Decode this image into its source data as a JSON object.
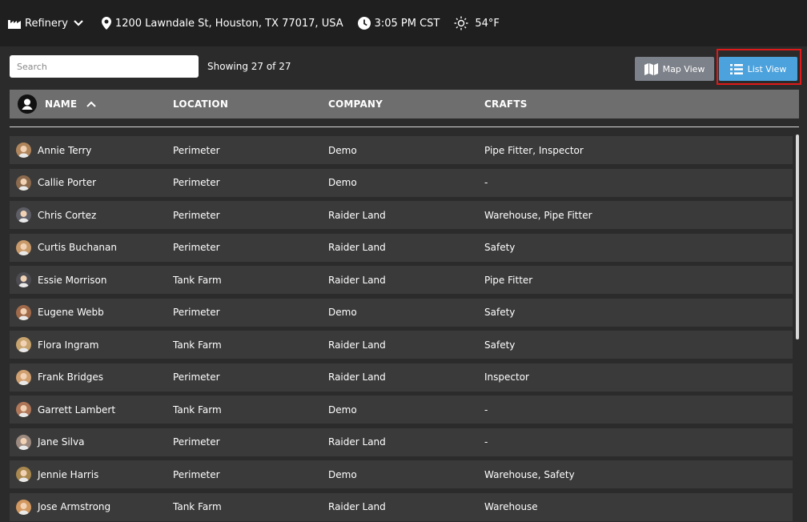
{
  "topbar": {
    "site": "Refinery",
    "address": "1200 Lawndale St, Houston, TX 77017, USA",
    "time": "3:05 PM CST",
    "temperature": "54°F",
    "icons": [
      "factory-icon",
      "chevron-down-icon",
      "location-pin-icon",
      "clock-icon",
      "sun-icon"
    ]
  },
  "toolbar": {
    "search_placeholder": "Search",
    "showing": "Showing 27 of 27",
    "map_view_label": "Map View",
    "list_view_label": "List View",
    "active_view": "list"
  },
  "table": {
    "columns": [
      "NAME",
      "LOCATION",
      "COMPANY",
      "CRAFTS"
    ],
    "sort_column": "NAME",
    "sort_direction": "ascending",
    "rows": [
      {
        "name": "Annie Terry",
        "location": "Perimeter",
        "company": "Demo",
        "crafts": "Pipe Fitter, Inspector"
      },
      {
        "name": "Callie Porter",
        "location": "Perimeter",
        "company": "Demo",
        "crafts": "-"
      },
      {
        "name": "Chris Cortez",
        "location": "Perimeter",
        "company": "Raider Land",
        "crafts": "Warehouse, Pipe Fitter"
      },
      {
        "name": "Curtis Buchanan",
        "location": "Perimeter",
        "company": "Raider Land",
        "crafts": "Safety"
      },
      {
        "name": "Essie Morrison",
        "location": "Tank Farm",
        "company": "Raider Land",
        "crafts": "Pipe Fitter"
      },
      {
        "name": "Eugene Webb",
        "location": "Perimeter",
        "company": "Demo",
        "crafts": "Safety"
      },
      {
        "name": "Flora Ingram",
        "location": "Tank Farm",
        "company": "Raider Land",
        "crafts": "Safety"
      },
      {
        "name": "Frank Bridges",
        "location": "Perimeter",
        "company": "Raider Land",
        "crafts": "Inspector"
      },
      {
        "name": "Garrett Lambert",
        "location": "Tank Farm",
        "company": "Demo",
        "crafts": "-"
      },
      {
        "name": "Jane Silva",
        "location": "Perimeter",
        "company": "Raider Land",
        "crafts": "-"
      },
      {
        "name": "Jennie Harris",
        "location": "Perimeter",
        "company": "Demo",
        "crafts": "Warehouse, Safety"
      },
      {
        "name": "Jose Armstrong",
        "location": "Tank Farm",
        "company": "Raider Land",
        "crafts": "Warehouse"
      }
    ]
  },
  "colors": {
    "accent": "#4ba2dd",
    "highlight": "#e01a1a",
    "avatars": [
      "#b0855c",
      "#8b6a4e",
      "#5e5e66",
      "#c89a6a",
      "#4c4c52",
      "#a06a4a",
      "#c7a36e",
      "#d0a070",
      "#b07658",
      "#9c8a80",
      "#a8884e",
      "#d29860"
    ]
  }
}
